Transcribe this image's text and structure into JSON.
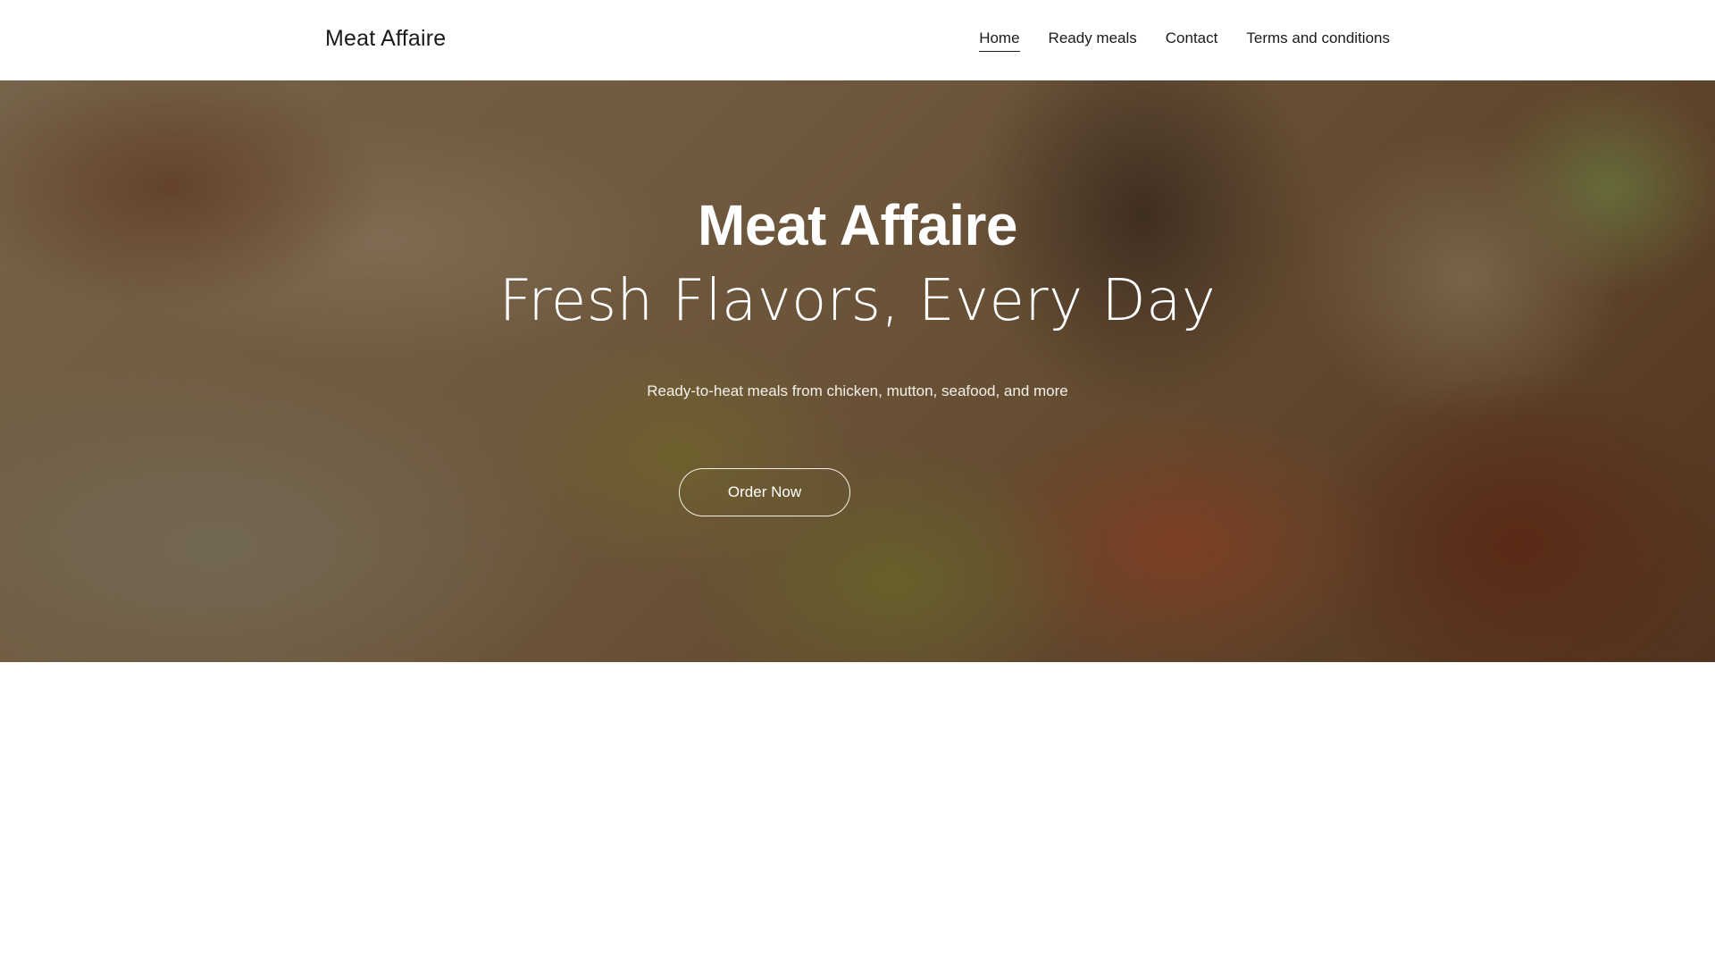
{
  "header": {
    "logo_text": "Meat Affaire",
    "nav": {
      "home": "Home",
      "ready_meals": "Ready meals",
      "contact": "Contact",
      "terms": "Terms and conditions"
    }
  },
  "hero": {
    "title": "Meat Affaire",
    "subtitle": "Fresh Flavors, Every Day",
    "description": "Ready-to-heat meals from chicken, mutton, seafood, and more",
    "cta_label": "Order Now"
  },
  "colors": {
    "text_dark": "#1a1a1a",
    "hero_text": "#ffffff",
    "background": "#ffffff"
  }
}
